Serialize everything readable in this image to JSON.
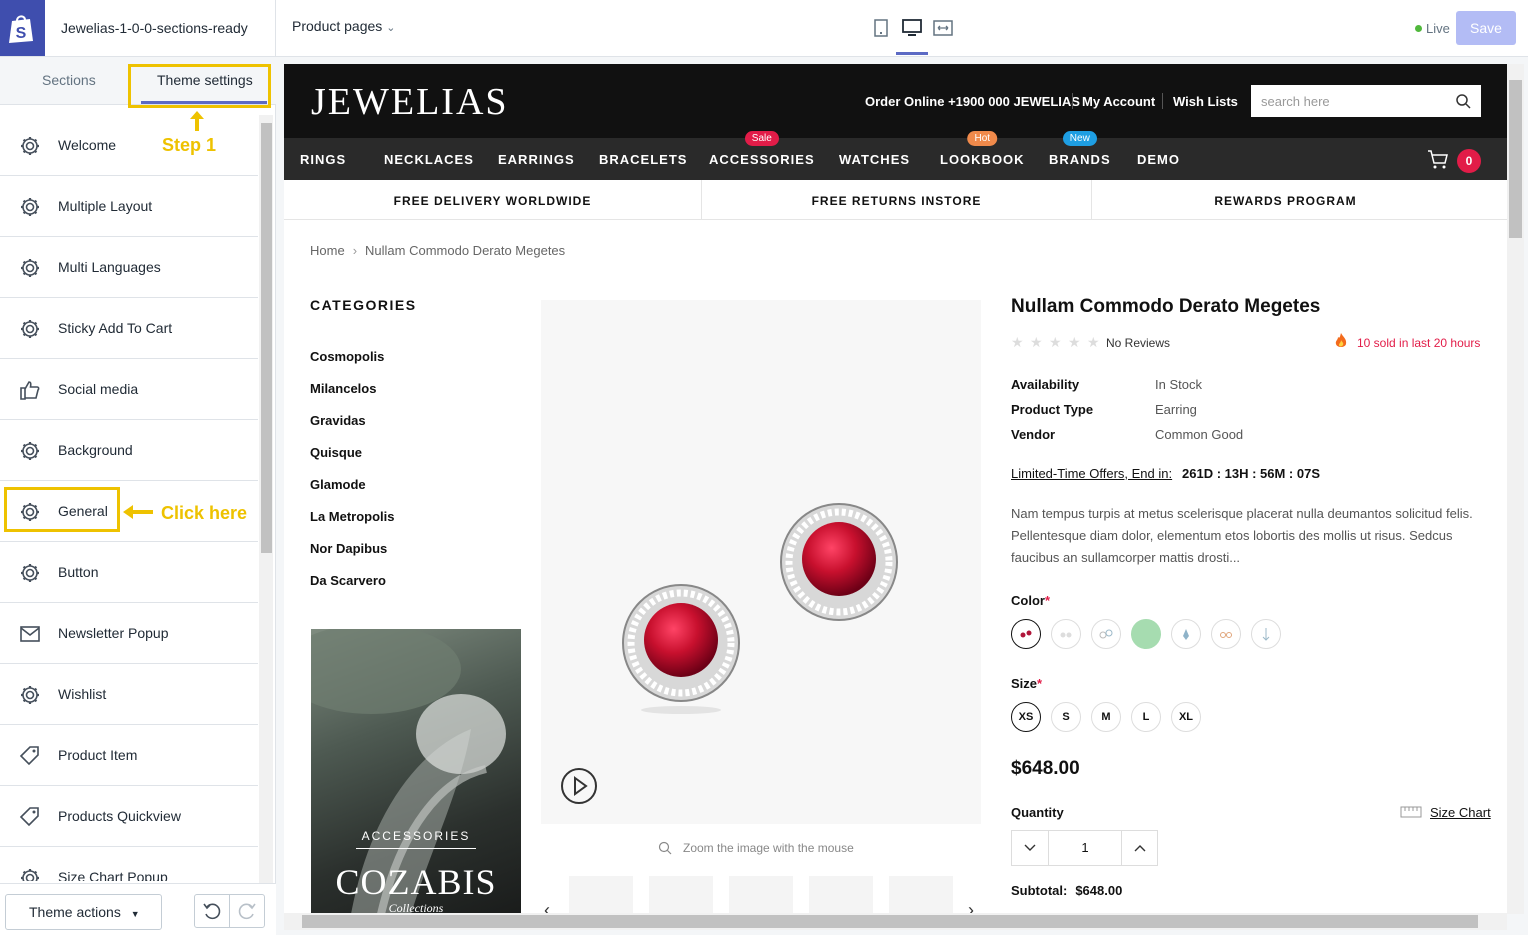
{
  "editor": {
    "store_name": "Jewelias-1-0-0-sections-ready",
    "page_selector": "Product pages",
    "live_label": "Live",
    "save_label": "Save"
  },
  "sidebar": {
    "tabs": [
      "Sections",
      "Theme settings"
    ],
    "items": [
      {
        "label": "Welcome",
        "icon": "gear-icon"
      },
      {
        "label": "Multiple Layout",
        "icon": "gear-icon"
      },
      {
        "label": "Multi Languages",
        "icon": "gear-icon"
      },
      {
        "label": "Sticky Add To Cart",
        "icon": "gear-icon"
      },
      {
        "label": "Social media",
        "icon": "thumbs-up-icon"
      },
      {
        "label": "Background",
        "icon": "gear-icon"
      },
      {
        "label": "General",
        "icon": "gear-icon"
      },
      {
        "label": "Button",
        "icon": "gear-icon"
      },
      {
        "label": "Newsletter Popup",
        "icon": "envelope-icon"
      },
      {
        "label": "Wishlist",
        "icon": "gear-icon"
      },
      {
        "label": "Product Item",
        "icon": "tag-icon"
      },
      {
        "label": "Products Quickview",
        "icon": "tag-icon"
      },
      {
        "label": "Size Chart Popup",
        "icon": "gear-icon"
      }
    ],
    "theme_actions": "Theme actions"
  },
  "annotations": {
    "step1": "Step 1",
    "click_here": "Click here"
  },
  "store": {
    "brand": "JEWELIAS",
    "order_online": "Order Online +1900 000 JEWELIAS",
    "my_account": "My Account",
    "wish_lists": "Wish Lists",
    "search_placeholder": "search here",
    "nav": [
      {
        "label": "RINGS"
      },
      {
        "label": "NECKLACES"
      },
      {
        "label": "EARRINGS"
      },
      {
        "label": "BRACELETS"
      },
      {
        "label": "ACCESSORIES",
        "badge": "Sale"
      },
      {
        "label": "WATCHES"
      },
      {
        "label": "LOOKBOOK",
        "badge": "Hot"
      },
      {
        "label": "BRANDS",
        "badge": "New"
      },
      {
        "label": "DEMO"
      }
    ],
    "cart_count": "0",
    "promo": [
      "FREE DELIVERY WORLDWIDE",
      "FREE RETURNS INSTORE",
      "REWARDS PROGRAM"
    ],
    "breadcrumb": {
      "home": "Home",
      "current": "Nullam Commodo Derato Megetes"
    },
    "categories_title": "CATEGORIES",
    "categories": [
      "Cosmopolis",
      "Milancelos",
      "Gravidas",
      "Quisque",
      "Glamode",
      "La Metropolis",
      "Nor Dapibus",
      "Da Scarvero"
    ],
    "banner": {
      "tag": "ACCESSORIES",
      "title": "COZABIS",
      "subtitle": "Collections"
    },
    "zoom_hint": "Zoom the image with the mouse",
    "product": {
      "title": "Nullam Commodo Derato Megetes",
      "reviews": "No Reviews",
      "rating": 0,
      "sold": "10 sold in last 20 hours",
      "attributes": [
        {
          "k": "Availability",
          "v": "In Stock"
        },
        {
          "k": "Product Type",
          "v": "Earring"
        },
        {
          "k": "Vendor",
          "v": "Common Good"
        }
      ],
      "offer_label": "Limited-Time Offers, End in:",
      "countdown": "261D : 13H : 56M : 07S",
      "description": "Nam tempus turpis at metus scelerisque placerat nulla deumantos solicitud felis. Pellentesque diam dolor, elementum etos lobortis des mollis ut risus. Sedcus faucibus an sullamcorper mattis drosti...",
      "color_label": "Color",
      "required_mark": "*",
      "size_label": "Size",
      "sizes": [
        "XS",
        "S",
        "M",
        "L",
        "XL"
      ],
      "price": "$648.00",
      "quantity_label": "Quantity",
      "size_chart": "Size Chart",
      "quantity": "1",
      "subtotal_label": "Subtotal:",
      "subtotal": "$648.00"
    }
  }
}
